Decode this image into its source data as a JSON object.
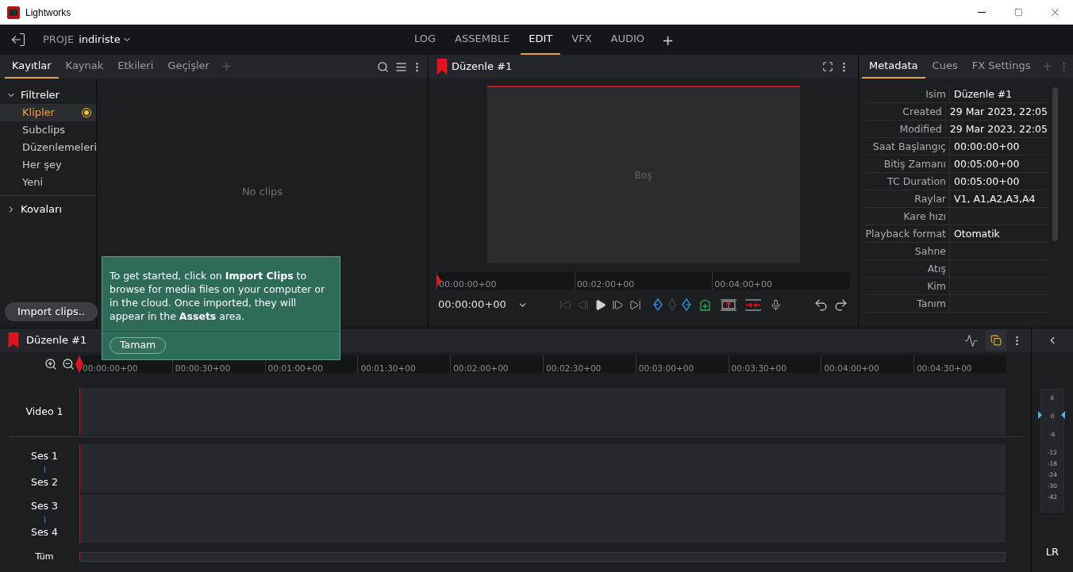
{
  "window": {
    "title": "Lightworks"
  },
  "top_bar": {
    "project_label": "PROJE",
    "project": "indiriste",
    "tabs": [
      {
        "label": "LOG",
        "selected": false
      },
      {
        "label": "ASSEMBLE",
        "selected": false
      },
      {
        "label": "EDIT",
        "selected": true
      },
      {
        "label": "VFX",
        "selected": false
      },
      {
        "label": "AUDIO",
        "selected": false
      }
    ],
    "add": "+"
  },
  "left_panel": {
    "tabs": [
      {
        "label": "Kayıtlar",
        "selected": true
      },
      {
        "label": "Kaynak",
        "selected": false
      },
      {
        "label": "Etkileri",
        "selected": false
      },
      {
        "label": "Geçişler",
        "selected": false
      }
    ],
    "add": "+",
    "groups": [
      {
        "label": "Filtreler",
        "expanded": true,
        "items": [
          {
            "label": "Klipler",
            "selected": true
          },
          {
            "label": "Subclips",
            "selected": false
          },
          {
            "label": "Düzenlemeleri",
            "selected": false
          },
          {
            "label": "Her şey",
            "selected": false
          },
          {
            "label": "Yeni",
            "selected": false
          }
        ]
      },
      {
        "label": "Kovaları",
        "expanded": false
      }
    ],
    "empty_text": "No clips",
    "import_button": "Import clips.."
  },
  "viewer": {
    "title": "Düzenle #1",
    "placeholder": "Boş",
    "ruler": [
      "00:00:00+00",
      "00:02:00+00",
      "00:04:00+00"
    ],
    "timecode": "00:00:00+00"
  },
  "metadata": {
    "tabs": [
      {
        "label": "Metadata",
        "selected": true
      },
      {
        "label": "Cues",
        "selected": false
      },
      {
        "label": "FX Settings",
        "selected": false
      }
    ],
    "add": "+",
    "rows": [
      {
        "label": "Isim",
        "value": "Düzenle #1"
      },
      {
        "label": "Created",
        "value": "29 Mar 2023, 22:05"
      },
      {
        "label": "Modified",
        "value": "29 Mar 2023, 22:05"
      },
      {
        "label": "Saat Başlangıç",
        "value": "00:00:00+00"
      },
      {
        "label": "Bitiş Zamanı",
        "value": "00:05:00+00"
      },
      {
        "label": "TC Duration",
        "value": "00:05:00+00"
      },
      {
        "label": "Raylar",
        "value": "V1, A1,A2,A3,A4"
      },
      {
        "label": "Kare hızı"
      },
      {
        "label": "Playback format",
        "value": "Otomatik"
      },
      {
        "label": "Sahne"
      },
      {
        "label": "Atış"
      },
      {
        "label": "Kim"
      },
      {
        "label": "Tanım"
      }
    ]
  },
  "timeline": {
    "title": "Düzenle #1",
    "ruler": [
      "00:00:00+00",
      "00:00:30+00",
      "00:01:00+00",
      "00:01:30+00",
      "00:02:00+00",
      "00:02:30+00",
      "00:03:00+00",
      "00:03:30+00",
      "00:04:00+00",
      "00:04:30+00"
    ],
    "tracks": [
      {
        "kind": "video",
        "labels": [
          "Video 1"
        ]
      },
      {
        "kind": "audio",
        "labels": [
          "Ses 1",
          "Ses 2"
        ]
      },
      {
        "kind": "audio",
        "labels": [
          "Ses 3",
          "Ses 4"
        ]
      }
    ],
    "all_label": "Tüm"
  },
  "meter": {
    "scale": [
      "6",
      "0",
      "-6",
      "-12",
      "-18",
      "-24",
      "-30",
      "-42"
    ],
    "label": "LR"
  },
  "tip": {
    "text": "To get started, click on **Import Clips** to browse for media files on your computer or in the cloud.  Once imported, they will appear in the **Assets** area.",
    "button": "Tamam"
  }
}
